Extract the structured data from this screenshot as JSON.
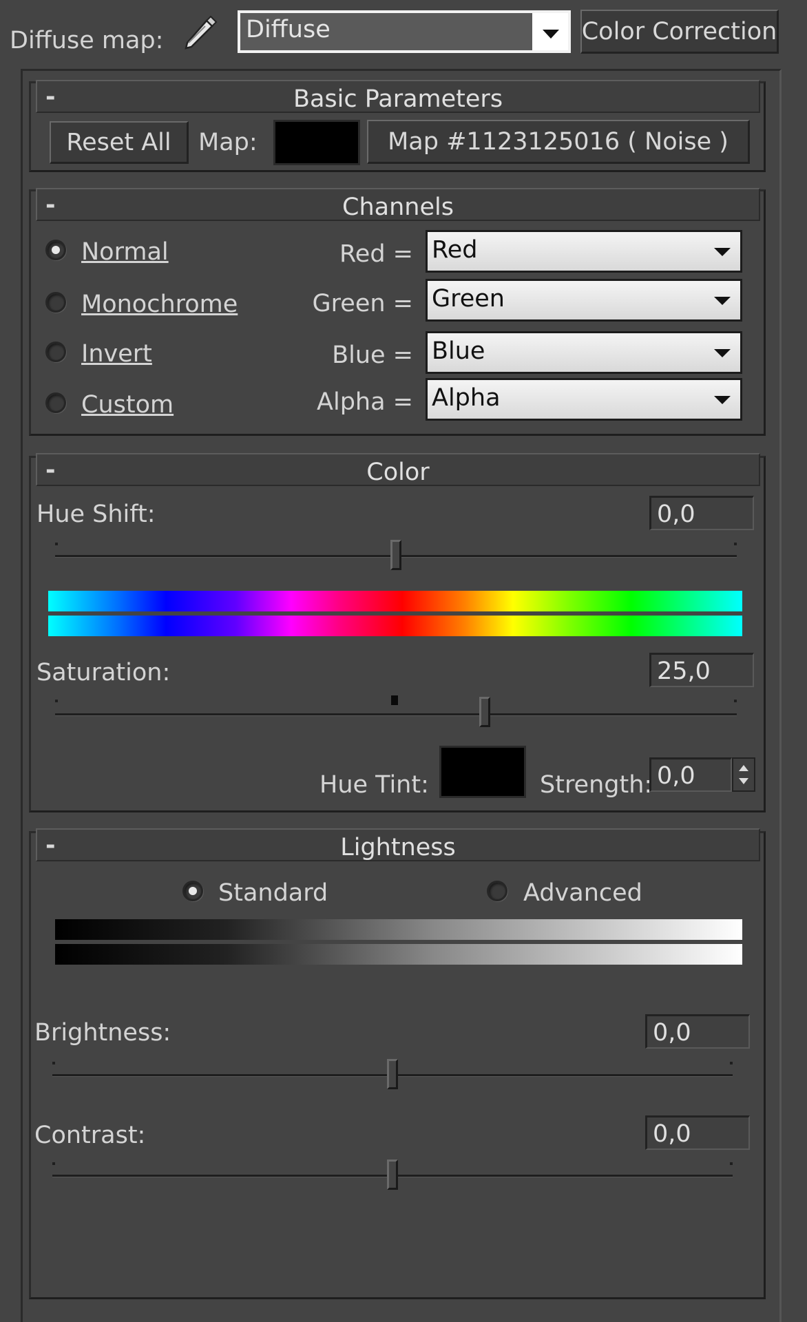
{
  "header": {
    "map_label": "Diffuse map:",
    "map_combo_value": "Diffuse",
    "correction_button": "Color Correction"
  },
  "basic": {
    "title": "Basic Parameters",
    "collapse": "-",
    "reset_label": "Reset All",
    "map_label": "Map:",
    "map_name": "Map #1123125016 ( Noise )"
  },
  "channels": {
    "title": "Channels",
    "collapse": "-",
    "modes": [
      {
        "label": "Normal",
        "selected": true
      },
      {
        "label": "Monochrome",
        "selected": false
      },
      {
        "label": "Invert",
        "selected": false
      },
      {
        "label": "Custom",
        "selected": false
      }
    ],
    "mappings": [
      {
        "label": "Red =",
        "value": "Red"
      },
      {
        "label": "Green =",
        "value": "Green"
      },
      {
        "label": "Blue =",
        "value": "Blue"
      },
      {
        "label": "Alpha =",
        "value": "Alpha"
      }
    ]
  },
  "color": {
    "title": "Color",
    "collapse": "-",
    "hue_shift_label": "Hue Shift:",
    "hue_shift_value": "0,0",
    "saturation_label": "Saturation:",
    "saturation_value": "25,0",
    "hue_tint_label": "Hue Tint:",
    "strength_label": "Strength:",
    "strength_value": "0,0",
    "hue_slider_level": 0.5,
    "saturation_slider_level": 0.63
  },
  "lightness": {
    "title": "Lightness",
    "collapse": "-",
    "standard_label": "Standard",
    "advanced_label": "Advanced",
    "brightness_label": "Brightness:",
    "brightness_value": "0,0",
    "contrast_label": "Contrast:",
    "contrast_value": "0,0",
    "brightness_slider_level": 0.5,
    "contrast_slider_level": 0.5
  },
  "colors": {
    "panel_bg": "#444444",
    "text": "#d4d4d4",
    "swatch": "#000000"
  }
}
